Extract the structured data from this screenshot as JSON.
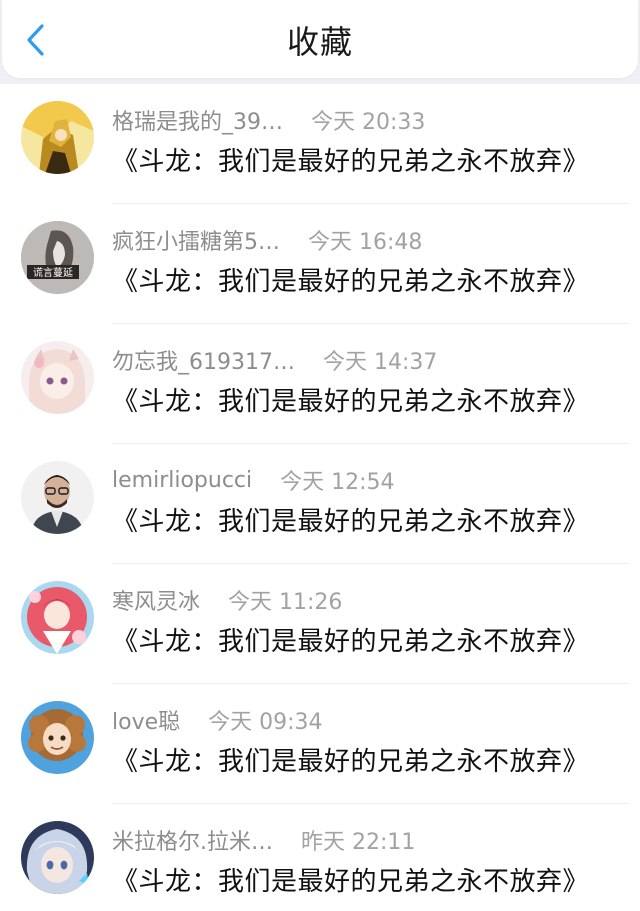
{
  "header": {
    "title": "收藏",
    "back_icon": "chevron-left-icon",
    "accent_color": "#2f9bf0"
  },
  "items": [
    {
      "name": "格瑞是我的_39…",
      "time": "今天 20:33",
      "text": "《斗龙：我们是最好的兄弟之永不放弃》",
      "avatar": "avatar-blonde-figure"
    },
    {
      "name": "疯狂小擂糖第5…",
      "time": "今天 16:48",
      "text": "《斗龙：我们是最好的兄弟之永不放弃》",
      "avatar": "avatar-gray-figure"
    },
    {
      "name": "勿忘我_619317…",
      "time": "今天 14:37",
      "text": "《斗龙：我们是最好的兄弟之永不放弃》",
      "avatar": "avatar-pink-anime-girl"
    },
    {
      "name": "lemirliopucci",
      "time": "今天 12:54",
      "text": "《斗龙：我们是最好的兄弟之永不放弃》",
      "avatar": "avatar-man-glasses"
    },
    {
      "name": "寒风灵冰",
      "time": "今天 11:26",
      "text": "《斗龙：我们是最好的兄弟之永不放弃》",
      "avatar": "avatar-red-anime-girl"
    },
    {
      "name": "love聪",
      "time": "今天 09:34",
      "text": "《斗龙：我们是最好的兄弟之永不放弃》",
      "avatar": "avatar-curly-hair-cartoon"
    },
    {
      "name": "米拉格尔.拉米…",
      "time": "昨天 22:11",
      "text": "《斗龙：我们是最好的兄弟之永不放弃》",
      "avatar": "avatar-silver-hair-cartoon"
    }
  ],
  "avatar_2_caption": "谎言蔓延"
}
